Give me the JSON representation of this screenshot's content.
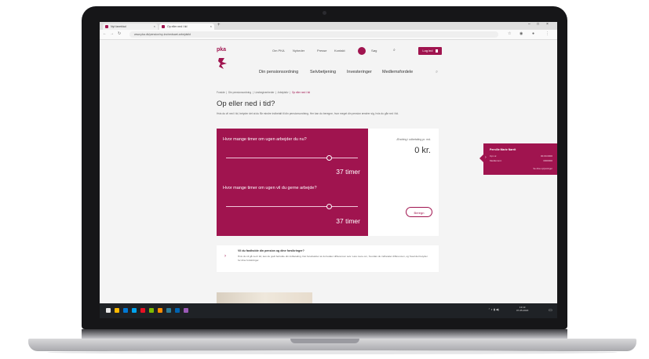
{
  "browser": {
    "tabs": [
      {
        "label": "Nyt faneblad"
      },
      {
        "label": "Op eller ned i tid"
      },
      {
        "label": "+"
      }
    ],
    "url": "www.pka.dk/pension/ny-lov/nedsaet-arbejdstid"
  },
  "header": {
    "logo": "pka",
    "top_nav": [
      "Om PKA",
      "Nyheder",
      "Presse",
      "Kontakt"
    ],
    "search_label": "Søg",
    "login_label": "Log ind",
    "main_nav": [
      "Din pensionsordning",
      "Selvbetjening",
      "Investeringer",
      "Medlemsfordele"
    ]
  },
  "breadcrumb": [
    "Forside",
    "Din pensionsordning",
    "Livsbegivenheder",
    "Arbejdsliv",
    "Op eller ned i tid"
  ],
  "page_title": "Op eller ned i tid?",
  "intro": "Hvis du vil ned i tid, betyder det at du får mindre indbetalt til din pensionsordning. Her kan du beregne, hvor meget din pension ændrer sig, hvis du går ned i tid.",
  "calculator": {
    "q1": "Hvor mange timer om ugen arbejder du nu?",
    "q1_value": "37 timer",
    "q1_level": 0.78,
    "q2": "Hvor mange timer om ugen vil du gerne arbejde?",
    "q2_value": "37 timer",
    "q2_level": 0.78,
    "result_label": "Ændring i udbetaling pr. md.",
    "result_value": "0 kr.",
    "more_label": "Beregn"
  },
  "info": {
    "title": "Vil du fastholde din pension og dine forsikringer?",
    "text": "Hvis du vil gå ned i tid, kan du godt beholde din indbetaling. Det forudsætter at du betaler differencen selv. Læs mere om, hvordan du indbetaler differencen, og hvad det betyder for dine forsikringer."
  },
  "member_card": {
    "name": "Pernille Marie Nørrit",
    "rows": [
      {
        "label": "Cpr-nr.",
        "value": "00.00.0000"
      },
      {
        "label": "Medlemsnr.",
        "value": "0000000"
      }
    ],
    "link": "Se dine oplysninger"
  },
  "taskbar": {
    "time": "13:13",
    "date": "07-05-2020",
    "icon_colors": [
      "#e6e6e6",
      "#ffb900",
      "#0078d4",
      "#00a4ef",
      "#e81123",
      "#7fba00",
      "#ff8c00",
      "#2d7d9a",
      "#0063b1",
      "#9b59b6"
    ]
  },
  "colors": {
    "brand": "#a0144f",
    "taskbar": "#1f2226"
  }
}
